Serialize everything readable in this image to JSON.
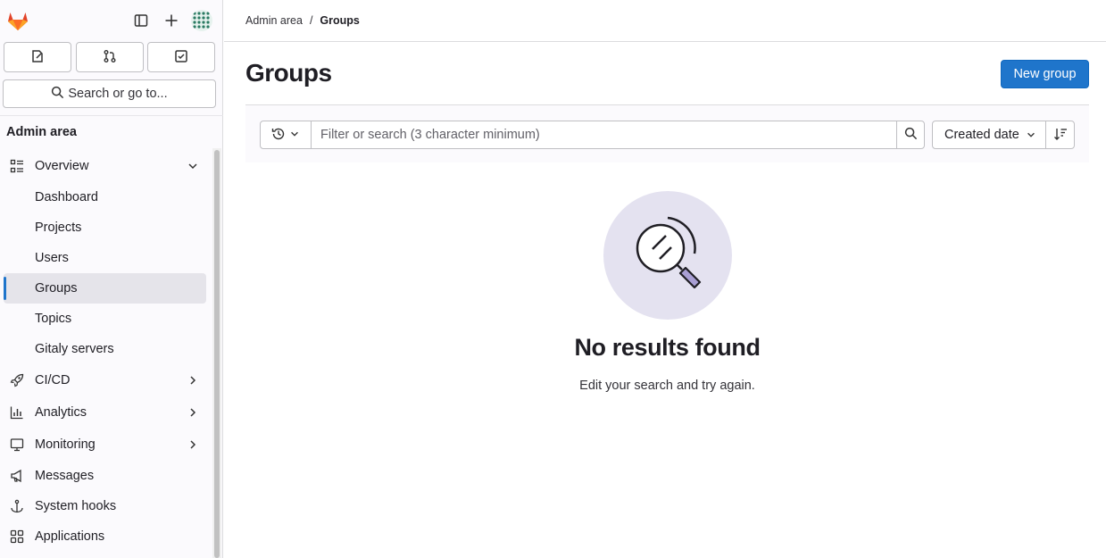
{
  "sidebar": {
    "search_label": "Search or go to...",
    "section_title": "Admin area",
    "items": [
      {
        "label": "Overview",
        "icon": "overview-icon"
      },
      {
        "label": "Dashboard"
      },
      {
        "label": "Projects"
      },
      {
        "label": "Users"
      },
      {
        "label": "Groups"
      },
      {
        "label": "Topics"
      },
      {
        "label": "Gitaly servers"
      },
      {
        "label": "CI/CD",
        "icon": "rocket-icon"
      },
      {
        "label": "Analytics",
        "icon": "chart-icon"
      },
      {
        "label": "Monitoring",
        "icon": "monitor-icon"
      },
      {
        "label": "Messages",
        "icon": "megaphone-icon"
      },
      {
        "label": "System hooks",
        "icon": "anchor-icon"
      },
      {
        "label": "Applications",
        "icon": "apps-icon"
      }
    ]
  },
  "breadcrumb": {
    "root": "Admin area",
    "sep": "/",
    "current": "Groups"
  },
  "header": {
    "title": "Groups",
    "new_button": "New group"
  },
  "filter": {
    "placeholder": "Filter or search (3 character minimum)",
    "value": "",
    "sort_label": "Created date"
  },
  "empty_state": {
    "title": "No results found",
    "description": "Edit your search and try again."
  },
  "colors": {
    "primary": "#1f75cb",
    "active_indicator": "#1f75cb",
    "illustration_bg": "#e4e2f0"
  }
}
